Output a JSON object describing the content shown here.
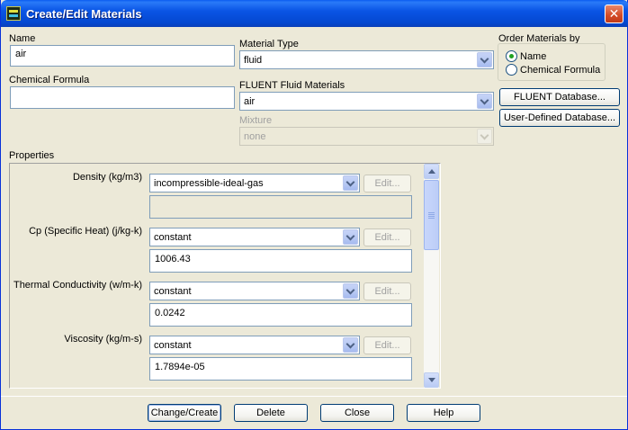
{
  "window": {
    "title": "Create/Edit Materials",
    "close_glyph": "✕"
  },
  "name": {
    "label": "Name",
    "value": "air"
  },
  "chemical_formula": {
    "label": "Chemical Formula",
    "value": ""
  },
  "material_type": {
    "label": "Material Type",
    "value": "fluid"
  },
  "fluent_fluid_materials": {
    "label": "FLUENT Fluid Materials",
    "value": "air"
  },
  "mixture": {
    "label": "Mixture",
    "value": "none"
  },
  "order_by": {
    "label": "Order Materials by",
    "options": [
      {
        "label": "Name",
        "selected": true
      },
      {
        "label": "Chemical Formula",
        "selected": false
      }
    ]
  },
  "database_buttons": {
    "fluent": "FLUENT Database...",
    "user_defined": "User-Defined Database..."
  },
  "properties": {
    "label": "Properties",
    "rows": [
      {
        "label": "Density (kg/m3)",
        "method": "incompressible-ideal-gas",
        "value": "",
        "edit": "Edit..."
      },
      {
        "label": "Cp (Specific Heat) (j/kg-k)",
        "method": "constant",
        "value": "1006.43",
        "edit": "Edit..."
      },
      {
        "label": "Thermal Conductivity (w/m-k)",
        "method": "constant",
        "value": "0.0242",
        "edit": "Edit..."
      },
      {
        "label": "Viscosity (kg/m-s)",
        "method": "constant",
        "value": "1.7894e-05",
        "edit": "Edit..."
      }
    ]
  },
  "footer": {
    "change_create": "Change/Create",
    "delete": "Delete",
    "close": "Close",
    "help": "Help"
  }
}
